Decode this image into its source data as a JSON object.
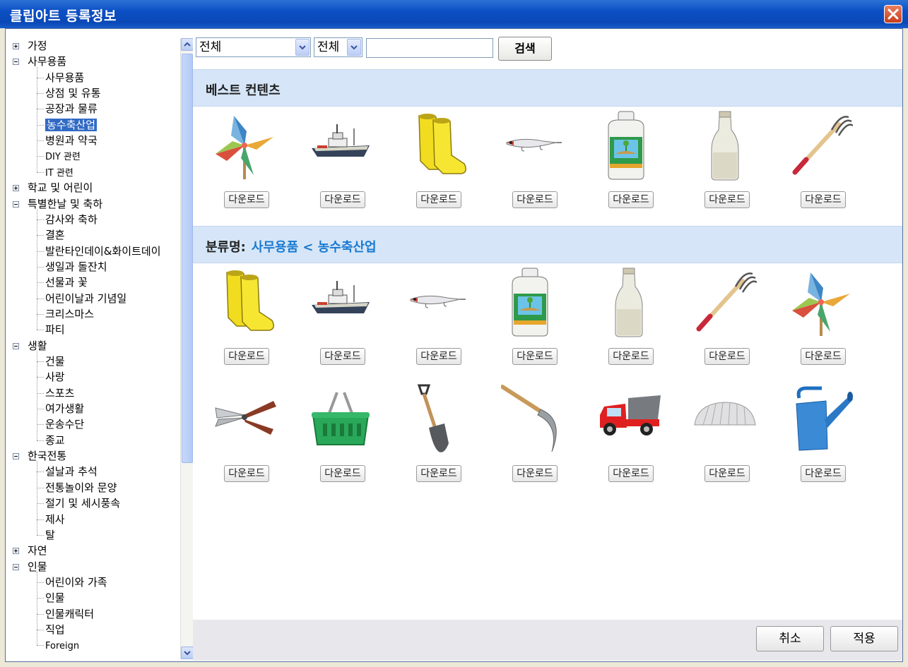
{
  "window": {
    "title": "클립아트 등록정보"
  },
  "tree": [
    {
      "label": "가정",
      "level": 0,
      "expander": "plus"
    },
    {
      "label": "사무용품",
      "level": 0,
      "expander": "minus"
    },
    {
      "label": "사무용품",
      "level": 1
    },
    {
      "label": "상점 및 유통",
      "level": 1
    },
    {
      "label": "공장과 물류",
      "level": 1
    },
    {
      "label": "농수축산업",
      "level": 1,
      "selected": true
    },
    {
      "label": "병원과 약국",
      "level": 1
    },
    {
      "label": "DIY 관련",
      "level": 1
    },
    {
      "label": "IT 관련",
      "level": 1
    },
    {
      "label": "학교 및 어린이",
      "level": 0,
      "expander": "plus"
    },
    {
      "label": "특별한날 및 축하",
      "level": 0,
      "expander": "minus"
    },
    {
      "label": "감사와 축하",
      "level": 1
    },
    {
      "label": "결혼",
      "level": 1
    },
    {
      "label": "발란타인데이&화이트데이",
      "level": 1
    },
    {
      "label": "생일과 돌잔치",
      "level": 1
    },
    {
      "label": "선물과 꽃",
      "level": 1
    },
    {
      "label": "어린이날과 기념일",
      "level": 1
    },
    {
      "label": "크리스마스",
      "level": 1
    },
    {
      "label": "파티",
      "level": 1
    },
    {
      "label": "생활",
      "level": 0,
      "expander": "minus"
    },
    {
      "label": "건물",
      "level": 1
    },
    {
      "label": "사랑",
      "level": 1
    },
    {
      "label": "스포츠",
      "level": 1
    },
    {
      "label": "여가생활",
      "level": 1
    },
    {
      "label": "운송수단",
      "level": 1
    },
    {
      "label": "종교",
      "level": 1
    },
    {
      "label": "한국전통",
      "level": 0,
      "expander": "minus"
    },
    {
      "label": "설날과 추석",
      "level": 1
    },
    {
      "label": "전통놀이와 문양",
      "level": 1
    },
    {
      "label": "절기 및 세시풍속",
      "level": 1
    },
    {
      "label": "제사",
      "level": 1
    },
    {
      "label": "탈",
      "level": 1
    },
    {
      "label": "자연",
      "level": 0,
      "expander": "plus"
    },
    {
      "label": "인물",
      "level": 0,
      "expander": "minus"
    },
    {
      "label": "어린이와 가족",
      "level": 1
    },
    {
      "label": "인물",
      "level": 1
    },
    {
      "label": "인물캐릭터",
      "level": 1
    },
    {
      "label": "직업",
      "level": 1
    },
    {
      "label": "Foreign",
      "level": 1
    }
  ],
  "toolbar": {
    "filter1": "전체",
    "filter2": "전체",
    "search_value": "",
    "search_label": "검색"
  },
  "best": {
    "title": "베스트 컨텐츠",
    "items": [
      "pinwheel-icon",
      "boat-icon",
      "rain-boots-icon",
      "fishing-lure-icon",
      "fertilizer-bottle-icon",
      "milk-bottle-icon",
      "rake-icon"
    ]
  },
  "category": {
    "label": "분류명:",
    "path": "사무용품 < 농수축산업",
    "items": [
      "rain-boots-icon",
      "boat-icon",
      "fishing-lure-icon",
      "fertilizer-bottle-icon",
      "milk-bottle-icon",
      "rake-icon",
      "pinwheel-icon",
      "pruning-shears-icon",
      "basket-icon",
      "shovel-icon",
      "sickle-icon",
      "dump-truck-icon",
      "greenhouse-icon",
      "watering-can-icon"
    ]
  },
  "download_label": "다운로드",
  "footer": {
    "cancel": "취소",
    "apply": "적용"
  }
}
